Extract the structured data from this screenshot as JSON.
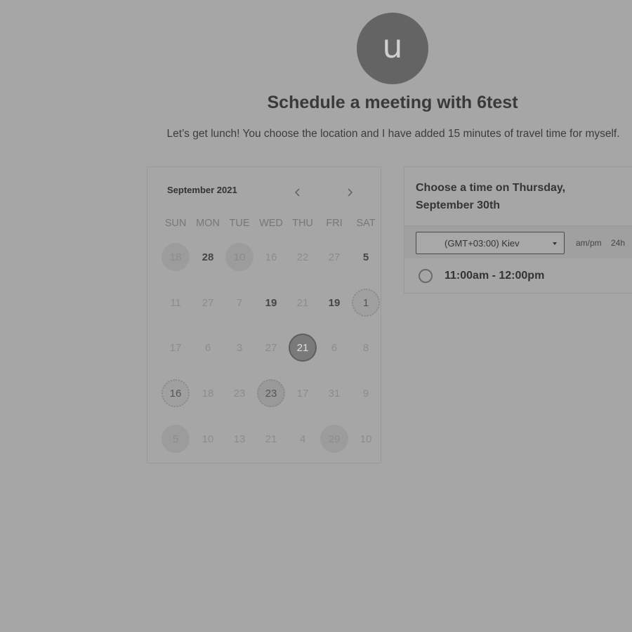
{
  "avatar": {
    "letter": "u"
  },
  "page": {
    "title": "Schedule a meeting with 6test",
    "description": "Let’s get lunch! You choose the location and I have added 15 minutes of travel time for myself."
  },
  "calendar": {
    "month_label": "September 2021",
    "prev_icon": "chevron-left-icon",
    "next_icon": "chevron-right-icon",
    "weekdays": [
      "SUN",
      "MON",
      "TUE",
      "WED",
      "THU",
      "FRI",
      "SAT"
    ],
    "weeks": [
      [
        {
          "d": "18",
          "s": "filled"
        },
        {
          "d": "28",
          "s": "bold"
        },
        {
          "d": "10",
          "s": "filled"
        },
        {
          "d": "16",
          "s": ""
        },
        {
          "d": "22",
          "s": ""
        },
        {
          "d": "27",
          "s": ""
        },
        {
          "d": "5",
          "s": "bold"
        }
      ],
      [
        {
          "d": "11",
          "s": ""
        },
        {
          "d": "27",
          "s": ""
        },
        {
          "d": "7",
          "s": ""
        },
        {
          "d": "19",
          "s": "bold"
        },
        {
          "d": "21",
          "s": ""
        },
        {
          "d": "19",
          "s": "bold"
        },
        {
          "d": "1",
          "s": "dotted"
        }
      ],
      [
        {
          "d": "17",
          "s": ""
        },
        {
          "d": "6",
          "s": ""
        },
        {
          "d": "3",
          "s": ""
        },
        {
          "d": "27",
          "s": ""
        },
        {
          "d": "21",
          "s": "selected"
        },
        {
          "d": "6",
          "s": ""
        },
        {
          "d": "8",
          "s": ""
        }
      ],
      [
        {
          "d": "16",
          "s": "dotted"
        },
        {
          "d": "18",
          "s": ""
        },
        {
          "d": "23",
          "s": ""
        },
        {
          "d": "23",
          "s": "dotted filled"
        },
        {
          "d": "17",
          "s": ""
        },
        {
          "d": "31",
          "s": ""
        },
        {
          "d": "9",
          "s": ""
        }
      ],
      [
        {
          "d": "5",
          "s": "filled"
        },
        {
          "d": "10",
          "s": ""
        },
        {
          "d": "13",
          "s": ""
        },
        {
          "d": "21",
          "s": ""
        },
        {
          "d": "4",
          "s": ""
        },
        {
          "d": "29",
          "s": "filled"
        },
        {
          "d": "10",
          "s": ""
        }
      ]
    ]
  },
  "times": {
    "header": "Choose a time on Thursday, September 30th",
    "timezone": "(GMT+03:00) Kiev",
    "format_ampm": "am/pm",
    "format_24h": "24h",
    "slots": [
      {
        "label": "11:00am - 12:00pm",
        "selected": false
      }
    ]
  }
}
